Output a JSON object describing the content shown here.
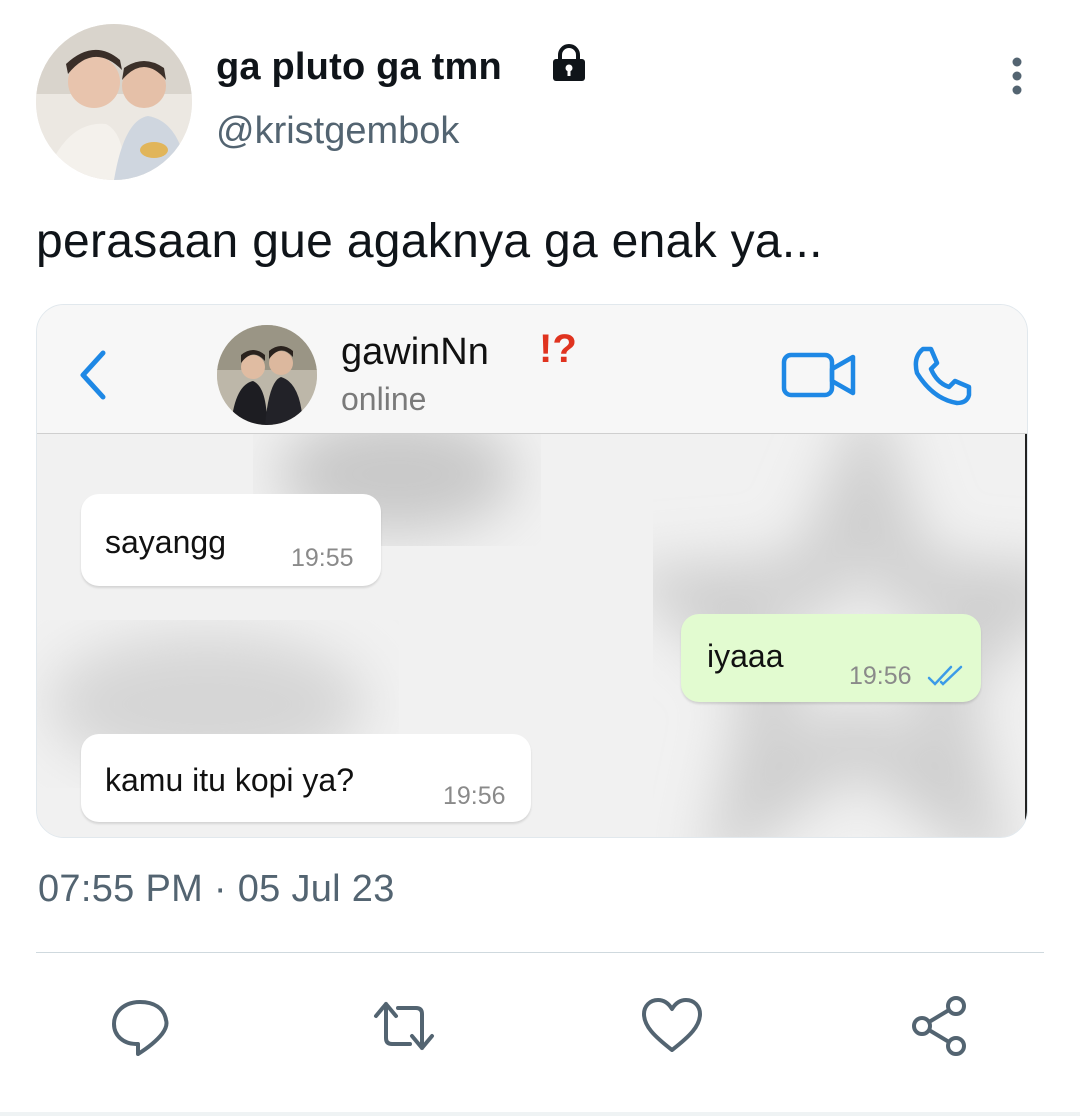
{
  "author": {
    "display_name": "ga pluto ga tmn",
    "handle": "@kristgembok",
    "avatar_icon": "profile-photo",
    "protected_icon": "lock-icon"
  },
  "tweet": {
    "text": "perasaan gue agaknya ga enak ya...",
    "timestamp": "07:55 PM · 05 Jul 23"
  },
  "chat_screenshot": {
    "contact_name": "gawinNn",
    "contact_emoji": "⁉️",
    "contact_status": "online",
    "messages": [
      {
        "direction": "incoming",
        "text": "sayangg",
        "time": "19:55"
      },
      {
        "direction": "outgoing",
        "text": "iyaaa",
        "time": "19:56",
        "read_receipt": "double-check-blue"
      },
      {
        "direction": "incoming",
        "text": "kamu itu kopi ya?",
        "time": "19:56"
      }
    ],
    "accent_color": "#1e88e5"
  },
  "actions": [
    "reply-icon",
    "retweet-icon",
    "like-icon",
    "share-icon"
  ],
  "colors": {
    "text_primary": "#0f1419",
    "text_secondary": "#536471",
    "outgoing_bubble": "#e2fbd0"
  }
}
